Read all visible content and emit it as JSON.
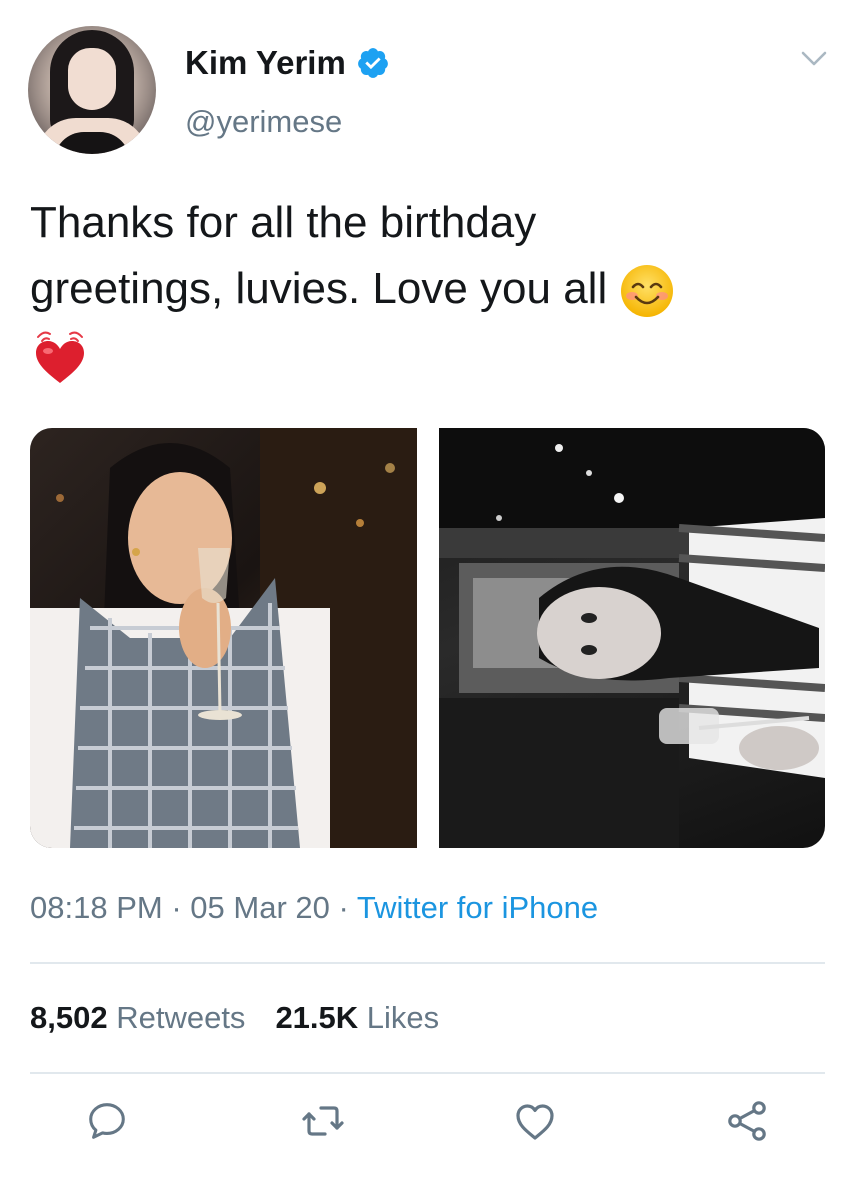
{
  "tweet": {
    "author": {
      "display_name": "Kim Yerim",
      "handle": "@yerimese",
      "verified": true
    },
    "text_line1": "Thanks for all the birthday",
    "text_line2": "greetings, luvies. Love you all",
    "emojis": [
      "smiling-face-emoji",
      "heart-emoji"
    ],
    "time": "08:18 PM",
    "date": "05 Mar 20",
    "separator": "·",
    "source": "Twitter for iPhone",
    "retweets_count": "8,502",
    "retweets_label": "Retweets",
    "likes_count": "21.5K",
    "likes_label": "Likes"
  },
  "actions": [
    "reply-icon",
    "retweet-icon",
    "like-icon",
    "share-icon"
  ],
  "colors": {
    "text": "#14171a",
    "muted": "#657786",
    "link": "#1b95e0",
    "verified": "#1da1f2",
    "divider": "#e1e8ed"
  }
}
